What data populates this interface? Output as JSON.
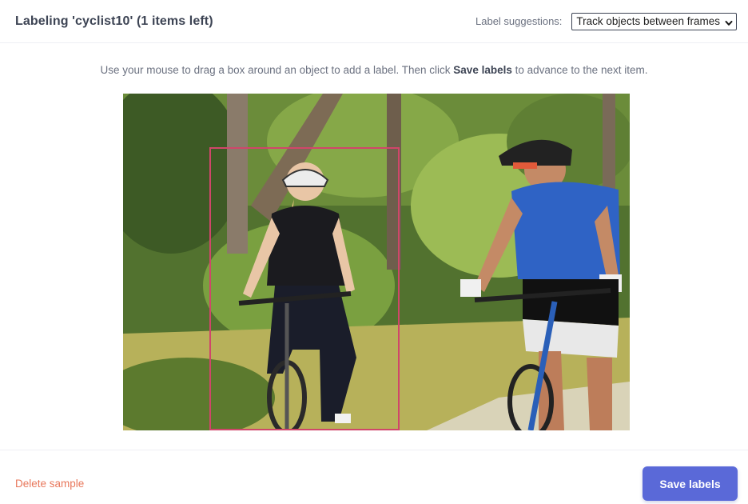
{
  "header": {
    "title": "Labeling 'cyclist10' (1 items left)",
    "suggestions_label": "Label suggestions:",
    "suggestions_selected": "Track objects between frames"
  },
  "instructions": {
    "before": "Use your mouse to drag a box around an object to add a label. Then click ",
    "emphasis": "Save labels",
    "after": " to advance to the next item."
  },
  "canvas": {
    "image_content": "two cyclists riding mountain bikes on a forest trail",
    "box_color": "#d0466a"
  },
  "footer": {
    "delete_label": "Delete sample",
    "save_label": "Save labels"
  },
  "colors": {
    "accent": "#5a69d8",
    "danger": "#e8775b"
  }
}
